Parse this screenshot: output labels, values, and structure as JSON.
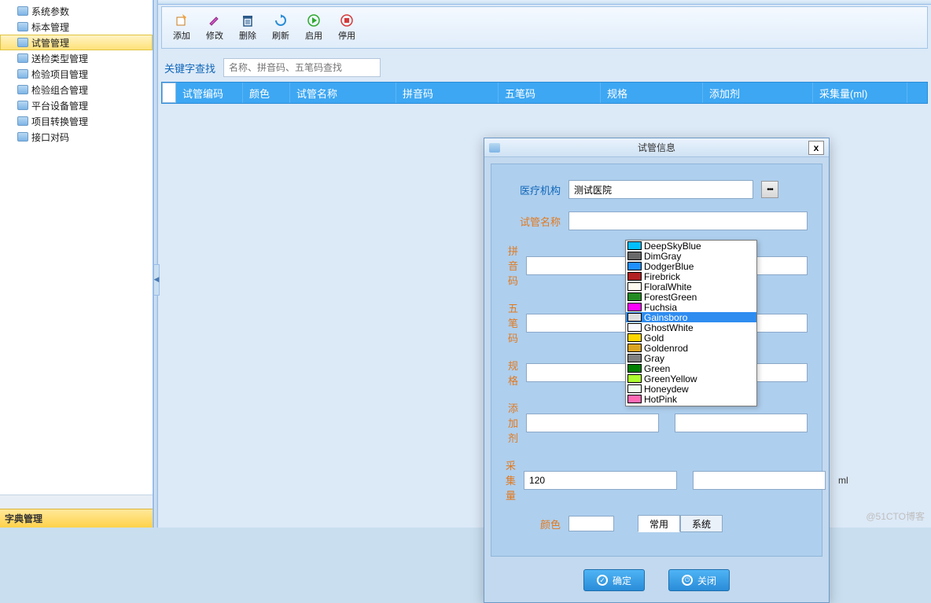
{
  "sidebar": {
    "items": [
      {
        "label": "系统参数"
      },
      {
        "label": "标本管理"
      },
      {
        "label": "试管管理",
        "selected": true
      },
      {
        "label": "送检类型管理"
      },
      {
        "label": "检验项目管理"
      },
      {
        "label": "检验组合管理"
      },
      {
        "label": "平台设备管理"
      },
      {
        "label": "项目转换管理"
      },
      {
        "label": "接口对码"
      }
    ],
    "footer": "字典管理"
  },
  "toolbar": {
    "add": "添加",
    "edit": "修改",
    "delete": "删除",
    "refresh": "刷新",
    "enable": "启用",
    "disable": "停用"
  },
  "search": {
    "label": "关键字查找",
    "placeholder": "名称、拼音码、五笔码查找"
  },
  "grid": {
    "cols": [
      "试管编码",
      "颜色",
      "试管名称",
      "拼音码",
      "五笔码",
      "规格",
      "添加剂",
      "采集量(ml)"
    ]
  },
  "dialog": {
    "title": "试管信息",
    "org_label": "医疗机构",
    "org_value": "测试医院",
    "name_label": "试管名称",
    "pinyin_label": "拼音码",
    "wubi_label": "五笔码",
    "spec_label": "规格",
    "additive_label": "添加剂",
    "volume_label": "采集量",
    "volume_value": "120",
    "volume_unit": "ml",
    "color_label": "颜色",
    "tab_common": "常用",
    "tab_system": "系统",
    "ok": "确定",
    "close": "关闭"
  },
  "colors": [
    {
      "name": "DeepSkyBlue",
      "hex": "#00BFFF"
    },
    {
      "name": "DimGray",
      "hex": "#696969"
    },
    {
      "name": "DodgerBlue",
      "hex": "#1E90FF"
    },
    {
      "name": "Firebrick",
      "hex": "#B22222"
    },
    {
      "name": "FloralWhite",
      "hex": "#FFFAF0"
    },
    {
      "name": "ForestGreen",
      "hex": "#228B22"
    },
    {
      "name": "Fuchsia",
      "hex": "#FF00FF"
    },
    {
      "name": "Gainsboro",
      "hex": "#DCDCDC",
      "selected": true
    },
    {
      "name": "GhostWhite",
      "hex": "#F8F8FF"
    },
    {
      "name": "Gold",
      "hex": "#FFD700"
    },
    {
      "name": "Goldenrod",
      "hex": "#DAA520"
    },
    {
      "name": "Gray",
      "hex": "#808080"
    },
    {
      "name": "Green",
      "hex": "#008000"
    },
    {
      "name": "GreenYellow",
      "hex": "#ADFF2F"
    },
    {
      "name": "Honeydew",
      "hex": "#F0FFF0"
    },
    {
      "name": "HotPink",
      "hex": "#FF69B4"
    }
  ],
  "watermark": "@51CTO博客"
}
